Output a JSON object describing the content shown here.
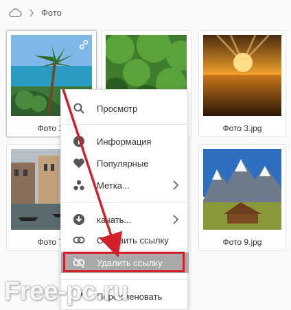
{
  "breadcrumb": {
    "root_icon": "cloud-icon",
    "separator_icon": "chevron-right-icon",
    "current": "Фото"
  },
  "tiles": [
    {
      "label": "Фото 1.",
      "selected": true
    },
    {
      "label": "",
      "selected": false
    },
    {
      "label": "Фото 3.jpg",
      "selected": false
    },
    {
      "label": "Фото 7.",
      "selected": false
    },
    {
      "label": "Фото 9.jpg",
      "selected": false
    }
  ],
  "context_menu": {
    "items": [
      {
        "icon": "search-icon",
        "label": "Просмотр"
      },
      {
        "icon": "info-icon",
        "label": "Информация"
      },
      {
        "icon": "heart-icon",
        "label": "Популярные"
      },
      {
        "icon": "tag-dots-icon",
        "label": "Метка...",
        "submenu": true
      },
      {
        "icon": "download-icon",
        "label": "качать...",
        "submenu": true
      },
      {
        "icon": "link-icon",
        "label": "Обновить ссылку"
      },
      {
        "icon": "unlink-icon",
        "label": "Удалить ссылку",
        "highlighted": true
      },
      {
        "icon": "pencil-icon",
        "label": "Переименовать"
      }
    ]
  },
  "annotation": {
    "arrow_color": "#d21f28",
    "box_color": "#d21f28"
  },
  "watermark": "Free-pc.ru",
  "colors": {
    "highlight": "#a9a9a9",
    "accent_red": "#d21f28"
  }
}
